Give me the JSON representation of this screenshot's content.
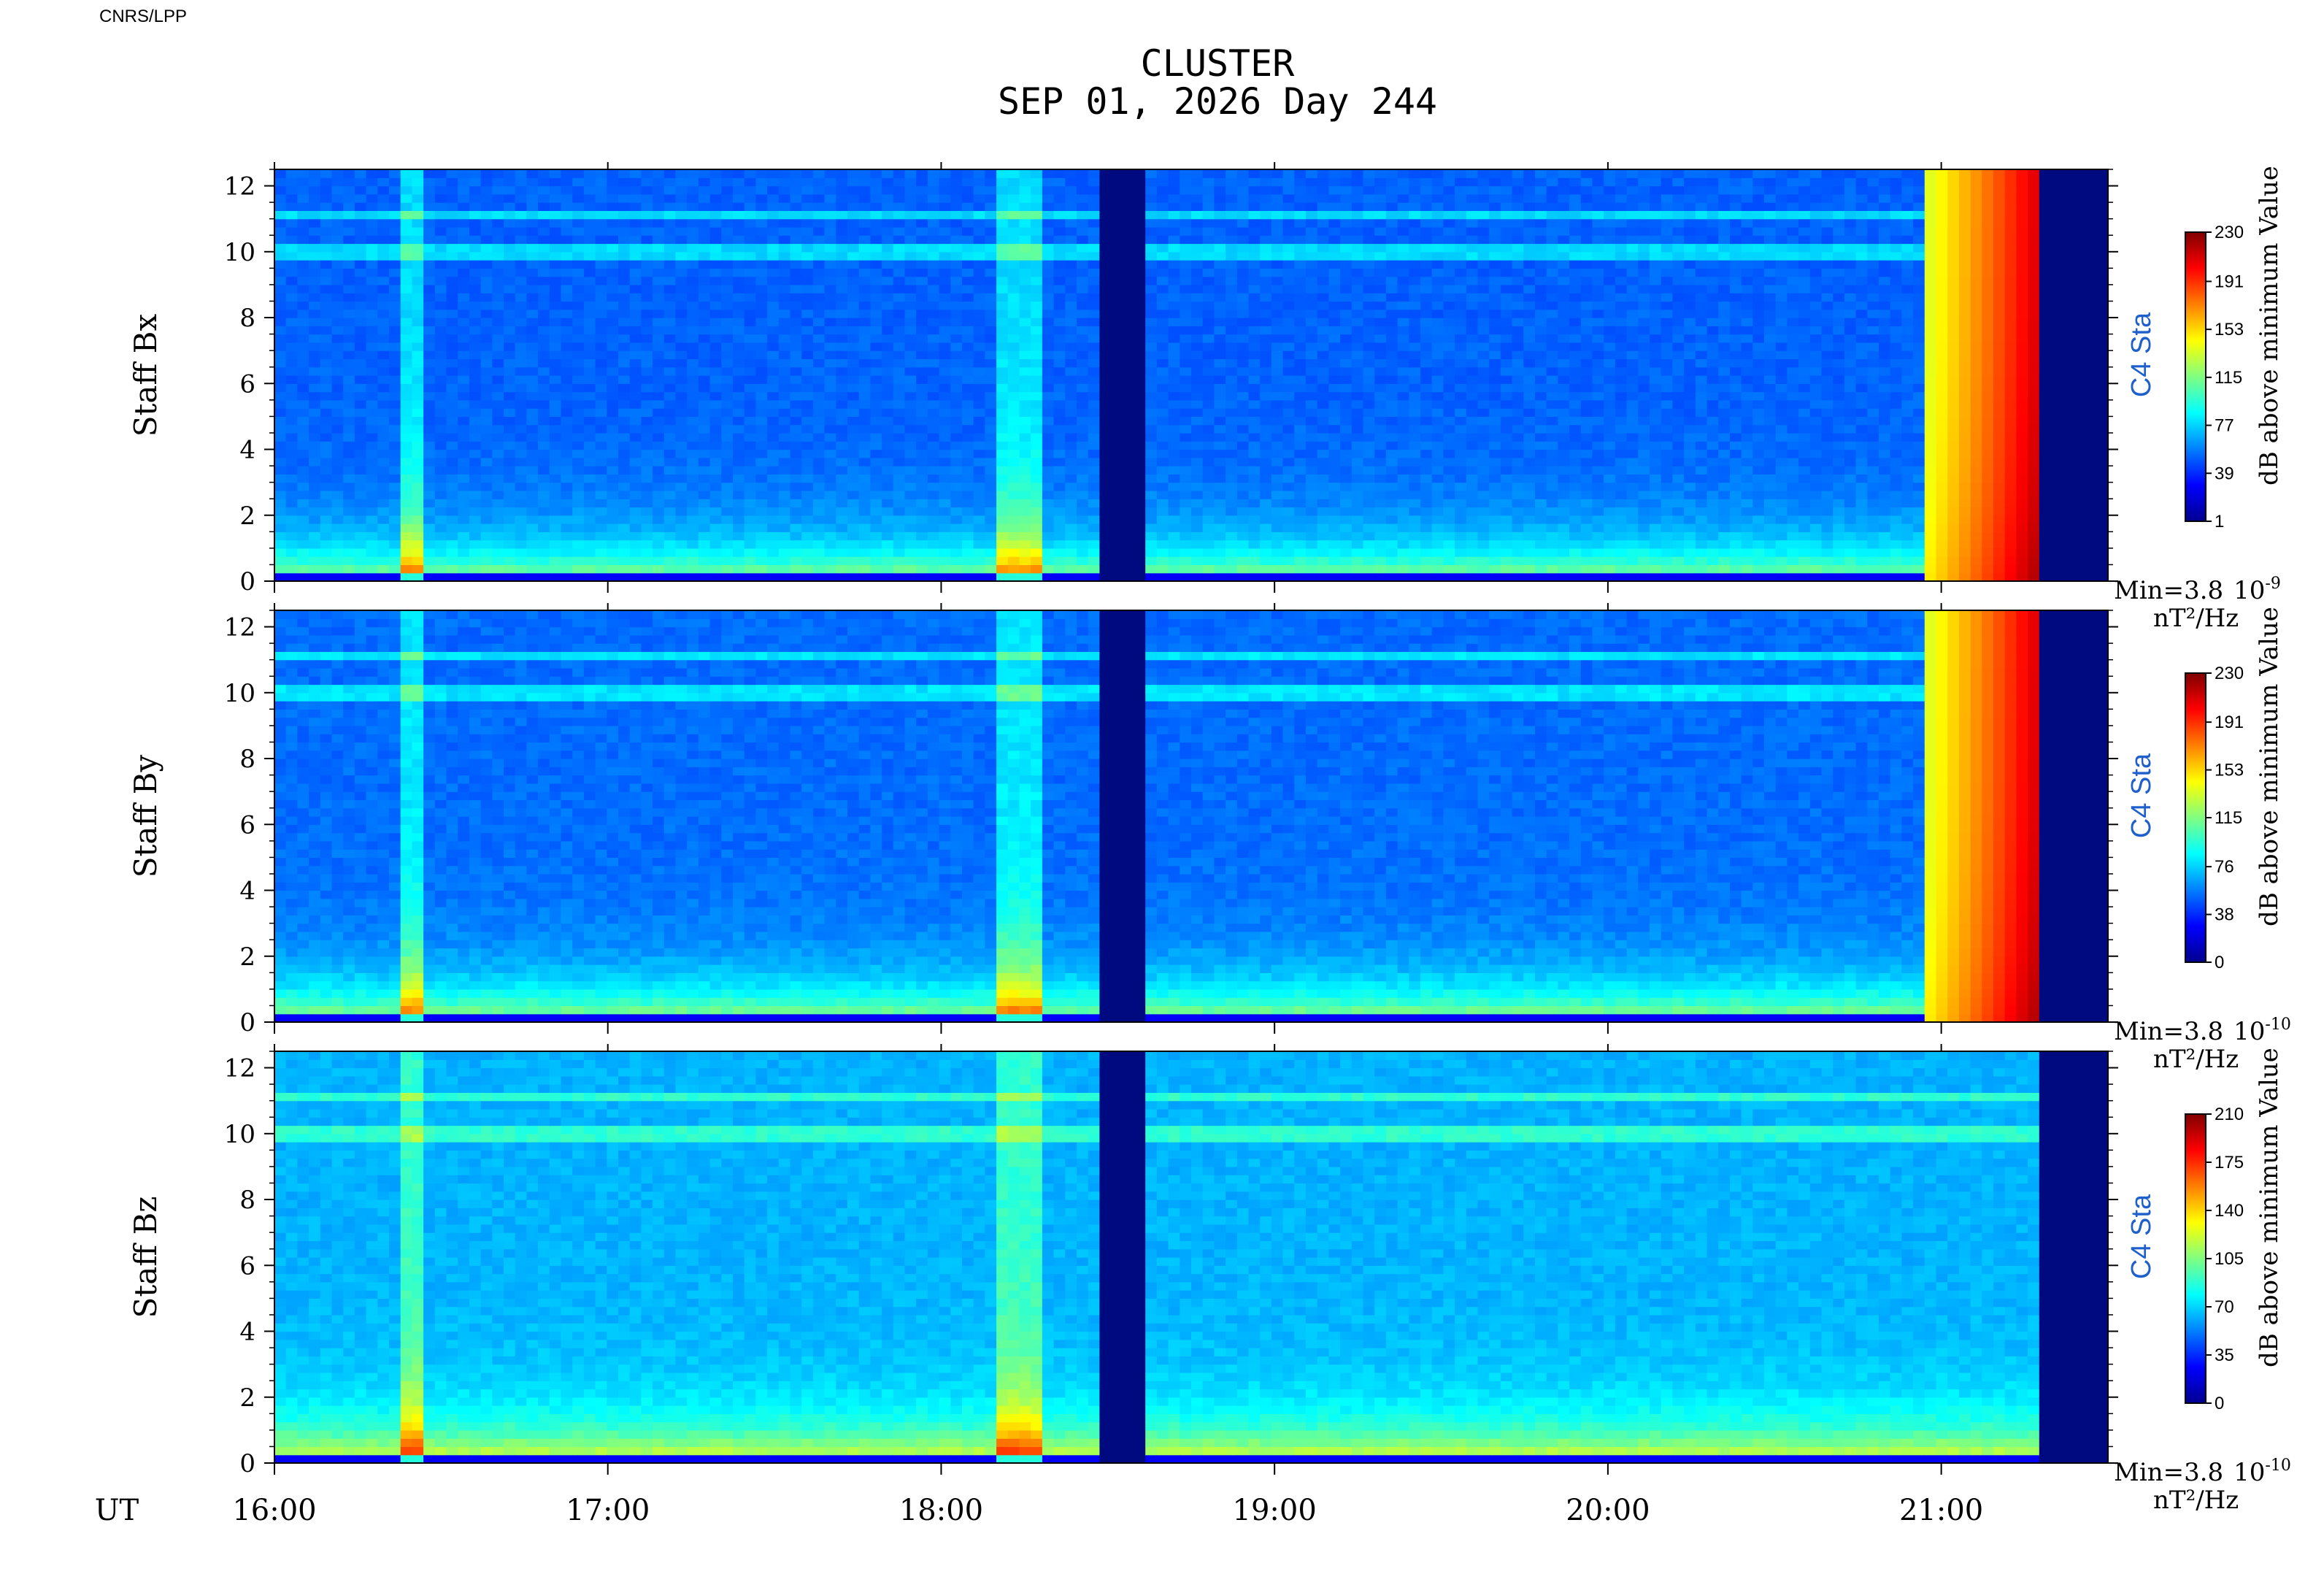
{
  "header": {
    "credit": "CNRS/LPP",
    "title": "CLUSTER",
    "subtitle": "SEP 01, 2026 Day 244"
  },
  "colors": {
    "bg": "#ffffff",
    "axis": "#000000",
    "spacecraft_label": "#1f5fcc",
    "data_gap": "#000a80"
  },
  "chart_data": [
    {
      "type": "heatmap",
      "ylabel": "Staff Bx",
      "spacecraft_label": "C4 Sta",
      "colorbar_label": "dB above minimum Value",
      "colorbar_ticks": [
        230,
        191,
        153,
        115,
        77,
        39,
        1
      ],
      "colorbar_range": [
        1,
        230
      ],
      "min_label": "Min=3.8",
      "min_exponent": "10",
      "min_exponent_power": "-9",
      "unit_label": "nT²/Hz",
      "ylim": [
        0,
        12.5
      ],
      "yticks": [
        0,
        2,
        4,
        6,
        8,
        10,
        12
      ],
      "background_level": 0.22,
      "has_burst": true
    },
    {
      "type": "heatmap",
      "ylabel": "Staff By",
      "spacecraft_label": "C4 Sta",
      "colorbar_label": "dB above minimum Value",
      "colorbar_ticks": [
        230,
        191,
        153,
        115,
        76,
        38,
        0
      ],
      "colorbar_range": [
        0,
        230
      ],
      "min_label": "Min=3.8",
      "min_exponent": "10",
      "min_exponent_power": "-10",
      "unit_label": "nT²/Hz",
      "ylim": [
        0,
        12.5
      ],
      "yticks": [
        0,
        2,
        4,
        6,
        8,
        10,
        12
      ],
      "background_level": 0.23,
      "has_burst": true
    },
    {
      "type": "heatmap",
      "ylabel": "Staff Bz",
      "spacecraft_label": "C4 Sta",
      "colorbar_label": "dB above minimum Value",
      "colorbar_ticks": [
        210,
        175,
        140,
        105,
        70,
        35,
        0
      ],
      "colorbar_range": [
        0,
        210
      ],
      "min_label": "Min=3.8",
      "min_exponent": "10",
      "min_exponent_power": "-10",
      "unit_label": "nT²/Hz",
      "ylim": [
        0,
        12.5
      ],
      "yticks": [
        0,
        2,
        4,
        6,
        8,
        10,
        12
      ],
      "background_level": 0.3,
      "has_burst": false
    }
  ],
  "x_axis": {
    "label": "UT",
    "ticks": [
      "16:00",
      "17:00",
      "18:00",
      "19:00",
      "20:00",
      "21:00"
    ],
    "tick_hours": [
      16,
      17,
      18,
      19,
      20,
      21
    ],
    "range_hours": [
      16.0,
      21.5
    ],
    "data_gaps": [
      [
        18.48,
        18.62
      ]
    ],
    "data_end_hour": 21.28,
    "burst_start_hour": 20.95
  }
}
